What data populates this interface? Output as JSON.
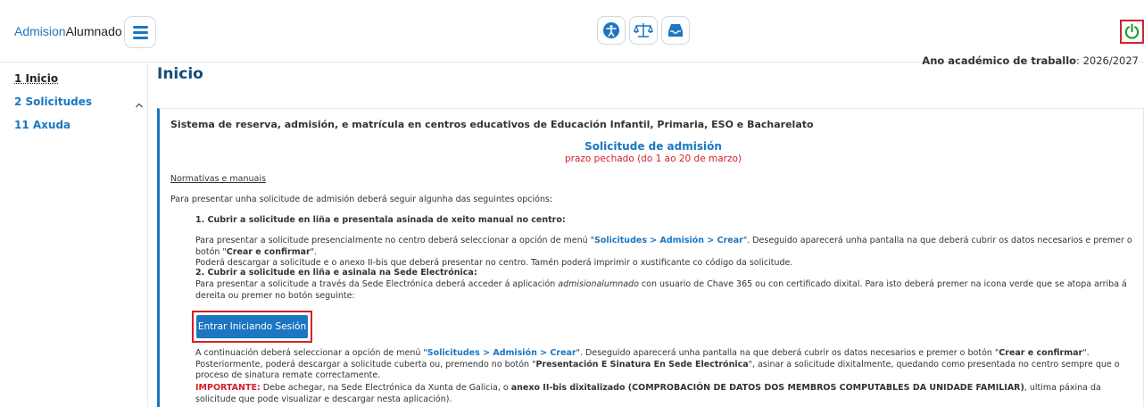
{
  "header": {
    "brand_part1": "Admision",
    "brand_part2": "Alumnado",
    "icons": [
      "accessibility-icon",
      "scales-icon",
      "inbox-icon"
    ],
    "power_icon": "power-icon"
  },
  "sidebar": {
    "items": [
      {
        "label": "1 Inicio",
        "active": true
      },
      {
        "label": "2 Solicitudes",
        "expandable": true
      },
      {
        "label": "11 Axuda"
      }
    ]
  },
  "year": {
    "label": "Ano académico de traballo",
    "value": ": 2026/2027"
  },
  "page_title": "Inicio",
  "content": {
    "system_title": "Sistema de reserva, admisión, e matrícula en centros educativos de Educación Infantil, Primaria, ESO e Bacharelato",
    "solicitude_title": "Solicitude de admisión",
    "solicitude_sub": "prazo pechado (do 1 ao 20 de marzo)",
    "normativas": "Normativas e manuais",
    "intro": "Para presentar unha solicitude de admisión deberá seguir algunha das seguintes opcións:",
    "option1_title": "1. Cubrir a solicitude en liña e presentala asinada de xeito manual no centro:",
    "option1_p1_a": "Para presentar a solicitude presencialmente no centro deberá seleccionar a opción de menú \"",
    "option1_p1_menu": "Solicitudes > Admisión > Crear",
    "option1_p1_b": "\". Deseguido aparecerá unha pantalla na que deberá cubrir os datos necesarios e premer o botón \"",
    "option1_p1_btn": "Crear e confirmar",
    "option1_p1_c": "\".",
    "option1_p2": "Poderá descargar a solicitude e o anexo II-bis que deberá presentar no centro. Tamén poderá imprimir o xustificante co código da solicitude.",
    "option2_title": "2. Cubrir a solicitude en liña e asinala na Sede Electrónica:",
    "option2_p_a": "Para presentar a solicitude a través da Sede Electrónica deberá acceder á aplicación ",
    "option2_p_app": "admisionalumnado",
    "option2_p_b": " con usuario de Chave 365 ou con certificado dixital. Para isto deberá premer na icona verde que se atopa arriba á dereita ou premer no botón seguinte:",
    "login_button": "Entrar Iniciando Sesión",
    "after_a": "A continuación deberá seleccionar a opción de menú \"",
    "after_menu": "Solicitudes > Admisión > Crear",
    "after_b": "\". Deseguido aparecerá unha pantalla na que deberá cubrir os datos necesarios e premer o botón \"",
    "after_btn": "Crear e confirmar",
    "after_c": "\". Posteriormente, poderá descargar a solicitude cuberta ou, premendo no botón \"",
    "after_btn2": "Presentación E Sinatura En Sede Electrónica",
    "after_d": "\", asinar a solicitude dixitalmente, quedando como presentada no centro sempre que o proceso de sinatura remate correctamente.",
    "important_label": "IMPORTANTE:",
    "important_a": " Debe achegar, na Sede Electrónica da Xunta de Galicia, o ",
    "important_b": "anexo II-bis dixitalizado (COMPROBACIÓN DE DATOS DOS MEMBROS COMPUTABLES DA UNIDADE FAMILIAR)",
    "important_c": ", ultima páxina da solicitude que pode visualizar e descargar nesta aplicación)."
  },
  "colors": {
    "primary": "#1c76c2",
    "title": "#124b7a",
    "alert": "#d4202a",
    "power": "#1e9e3a"
  }
}
